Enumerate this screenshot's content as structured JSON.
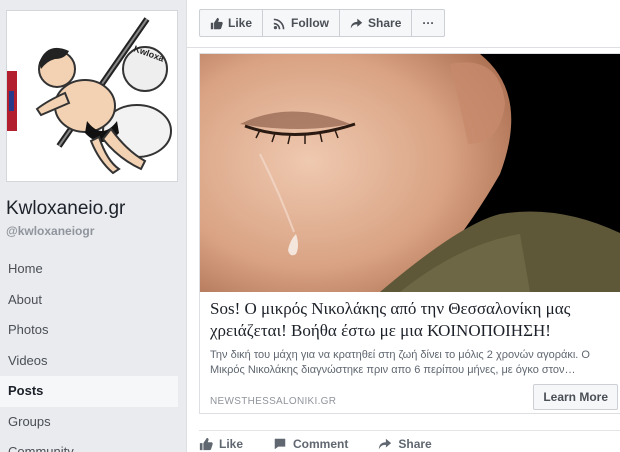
{
  "page": {
    "name": "Kwloxaneio.gr",
    "handle": "@kwloxaneiogr"
  },
  "nav": [
    "Home",
    "About",
    "Photos",
    "Videos",
    "Posts",
    "Groups",
    "Community"
  ],
  "nav_active": "Posts",
  "actions": {
    "like": "Like",
    "follow": "Follow",
    "share": "Share",
    "more": "···"
  },
  "post": {
    "headline": "Sos! Ο μικρός Νικολάκης από την Θεσσαλονίκη μας χρειάζεται! Βοήθα έστω με μια ΚΟΙΝΟΠΟΙΗΣΗ!",
    "description": "Την δική του μάχη για να κρατηθεί στη ζωή δίνει το μόλις 2 χρονών αγοράκι. Ο Μικρός Νικολάκης διαγνώστηκε πριν απο 6 περίπου μήνες, με όγκο στον…",
    "domain": "NEWSTHESSALONIKI.GR",
    "cta": "Learn More"
  },
  "footer": {
    "like": "Like",
    "comment": "Comment",
    "share": "Share"
  }
}
